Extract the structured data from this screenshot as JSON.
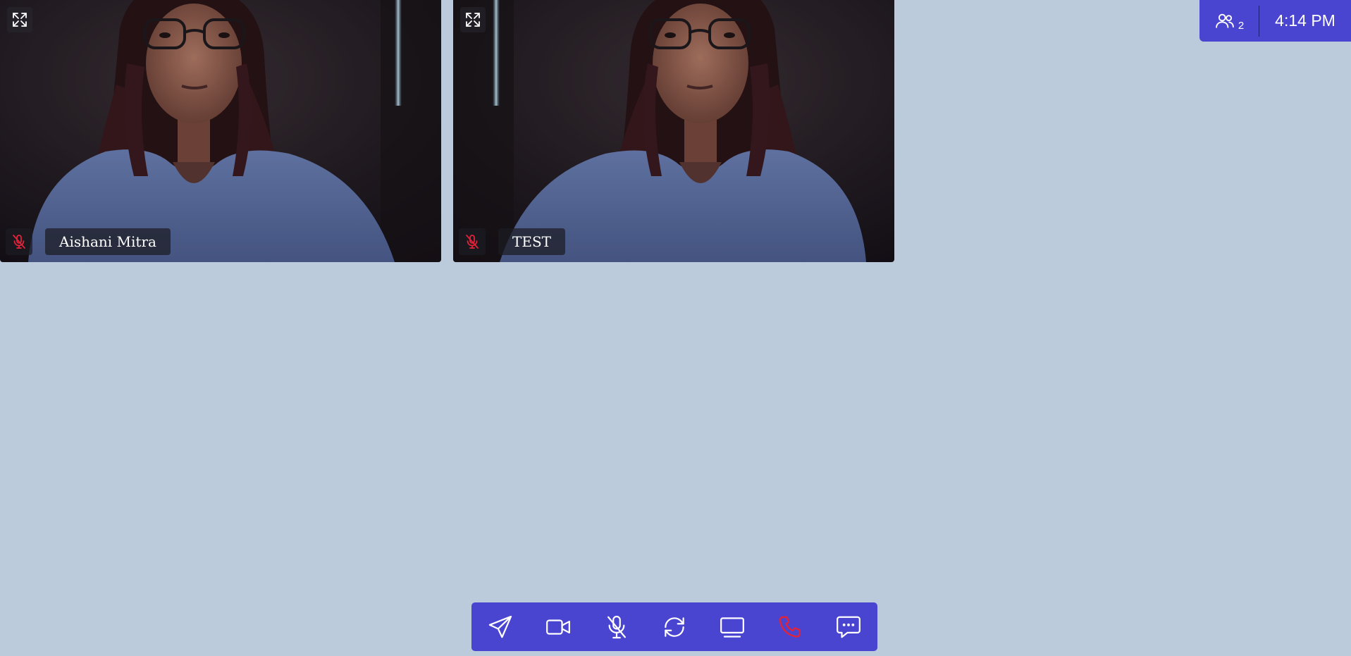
{
  "tiles": [
    {
      "name": "Aishani Mitra",
      "mic_state": "muted",
      "mirrored": false
    },
    {
      "name": "TEST",
      "mic_state": "muted",
      "mirrored": true
    }
  ],
  "info_panel": {
    "participant_count": "2",
    "time": "4:14 PM",
    "icon": "participants-icon"
  },
  "controls": [
    {
      "id": "send",
      "icon": "send-icon"
    },
    {
      "id": "video",
      "icon": "video-camera-icon"
    },
    {
      "id": "mic",
      "icon": "microphone-off-icon"
    },
    {
      "id": "switch-camera",
      "icon": "refresh-icon"
    },
    {
      "id": "share-screen",
      "icon": "monitor-icon"
    },
    {
      "id": "end-call",
      "icon": "phone-icon",
      "color": "#e0233a"
    },
    {
      "id": "chat",
      "icon": "chat-icon"
    }
  ],
  "colors": {
    "background": "#bccbdb",
    "accent": "#4a45d1",
    "muted_red": "#e0233a",
    "icon_white": "#ffffff"
  }
}
